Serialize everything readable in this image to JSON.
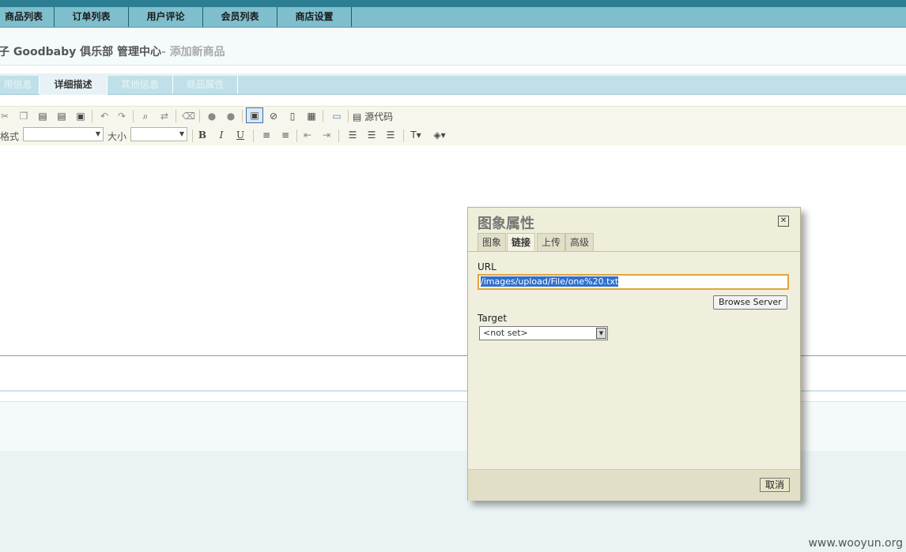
{
  "nav": {
    "items": [
      {
        "label": "商品列表"
      },
      {
        "label": "订单列表"
      },
      {
        "label": "用户评论"
      },
      {
        "label": "会员列表"
      },
      {
        "label": "商店设置"
      }
    ]
  },
  "header": {
    "title": "子 Goodbaby 俱乐部 管理中心",
    "subtitle": "- 添加新商品"
  },
  "tabs": [
    {
      "label": "用信息"
    },
    {
      "label": "详细描述"
    },
    {
      "label": "其他信息"
    },
    {
      "label": "商品属性"
    }
  ],
  "editor": {
    "format_label": "格式",
    "size_label": "大小",
    "source_label": "源代码",
    "bold": "B",
    "italic": "I",
    "underline": "U"
  },
  "dialog": {
    "title": "图象属性",
    "tabs": [
      {
        "label": "图象"
      },
      {
        "label": "链接"
      },
      {
        "label": "上传"
      },
      {
        "label": "高级"
      }
    ],
    "url_label": "URL",
    "url_value": "/images/upload/File/one%20.txt",
    "browse_button": "Browse Server",
    "target_label": "Target",
    "target_value": "<not set>",
    "cancel_button": "取消"
  },
  "watermark": "www.wooyun.org"
}
